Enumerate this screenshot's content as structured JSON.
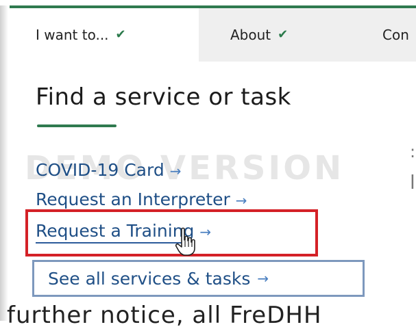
{
  "nav": {
    "tabs": [
      {
        "label": "I want to...",
        "active": true
      },
      {
        "label": "About",
        "active": false
      },
      {
        "label": "Con",
        "active": false
      }
    ],
    "chevron": "chevron-down-icon"
  },
  "dropdown": {
    "title": "Find a service or task",
    "watermark": "DEMO VERSION",
    "links": [
      {
        "label": "COVID-19 Card",
        "arrow": "→"
      },
      {
        "label": "Request an Interpreter",
        "arrow": "→"
      },
      {
        "label": "Request a Training",
        "arrow": "→"
      }
    ],
    "see_all": {
      "label": "See all services & tasks",
      "arrow": "→"
    }
  },
  "page": {
    "bottom_text": "further notice, all FreDHH"
  },
  "colors": {
    "accent_green": "#2f7a4f",
    "link_blue": "#1f4f86",
    "highlight_red": "#d42127",
    "box_border_blue": "#7d98bd"
  }
}
